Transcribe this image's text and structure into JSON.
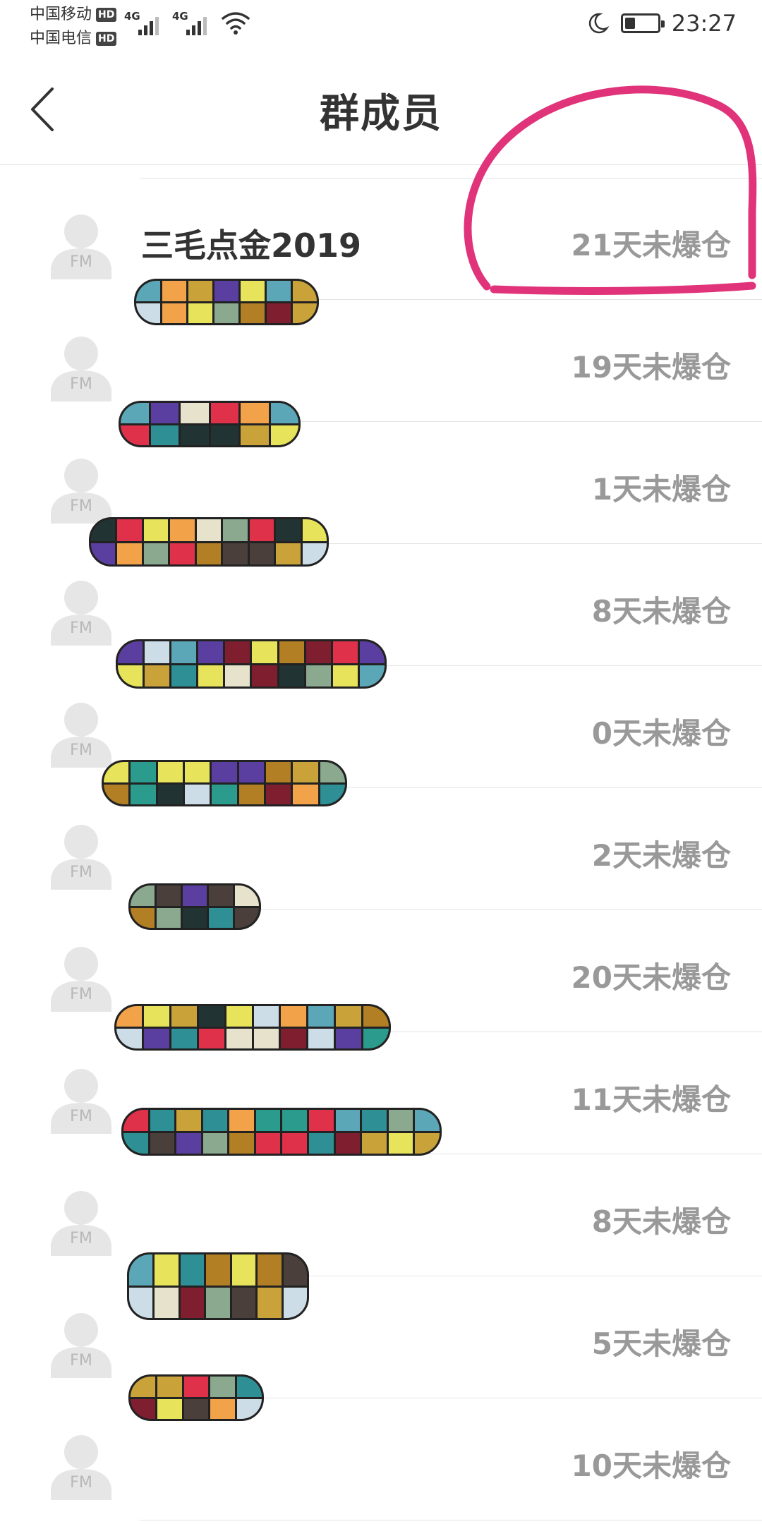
{
  "status_bar": {
    "carrier1": "中国移动",
    "carrier2": "中国电信",
    "hd": "HD",
    "network1": "4G",
    "network2": "4G",
    "time": "23:27"
  },
  "header": {
    "title": "群成员"
  },
  "avatar_initials": "FM",
  "members": [
    {
      "name": "三毛点金2019",
      "status": "21天未爆仓"
    },
    {
      "name": "",
      "status": "19天未爆仓"
    },
    {
      "name": "",
      "status": "1天未爆仓"
    },
    {
      "name": "",
      "status": "8天未爆仓"
    },
    {
      "name": "",
      "status": "0天未爆仓"
    },
    {
      "name": "",
      "status": "2天未爆仓"
    },
    {
      "name": "",
      "status": "20天未爆仓"
    },
    {
      "name": "",
      "status": "11天未爆仓"
    },
    {
      "name": "",
      "status": "8天未爆仓"
    },
    {
      "name": "",
      "status": "5天未爆仓"
    },
    {
      "name": "",
      "status": "10天未爆仓"
    }
  ],
  "colors": {
    "annotation": "#e0337a",
    "status_text": "#999999",
    "avatar": "#e6e6e6"
  }
}
